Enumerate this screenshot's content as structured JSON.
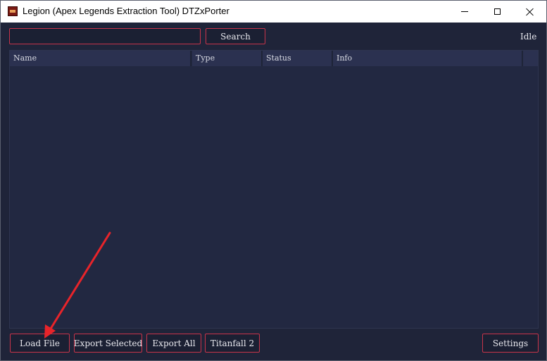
{
  "window": {
    "title": "Legion (Apex Legends Extraction Tool) DTZxPorter",
    "icon": "legion-app-icon"
  },
  "toolbar": {
    "search_value": "",
    "search_label": "Search",
    "status": "Idle"
  },
  "table": {
    "columns": [
      "Name",
      "Type",
      "Status",
      "Info",
      ""
    ],
    "rows": []
  },
  "actions": {
    "load_file": "Load File",
    "export_selected": "Export Selected",
    "export_all": "Export All",
    "titanfall2": "Titanfall 2",
    "settings": "Settings"
  },
  "colors": {
    "background": "#1f2439",
    "accent_border": "#c8344a",
    "header_bg": "#2b3150",
    "annotation_arrow": "#e8242a"
  }
}
